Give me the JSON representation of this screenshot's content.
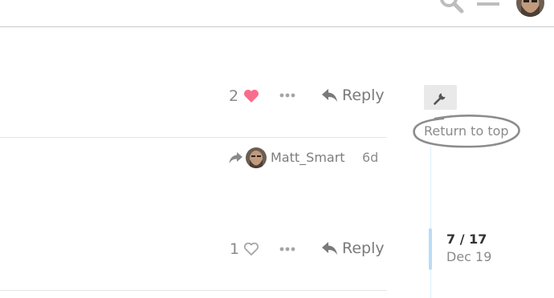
{
  "header": {
    "icons": [
      "search-icon",
      "hamburger-menu-icon",
      "user-avatar"
    ]
  },
  "post1": {
    "like_count": "2",
    "liked": true,
    "like_color": "#fa6c8d",
    "reply_label": "Reply"
  },
  "post2": {
    "reply_to_user": "Matt_Smart",
    "age": "6d",
    "like_count": "1",
    "liked": false,
    "reply_label": "Reply"
  },
  "timeline": {
    "return_to_top": "Return to top",
    "position": "7 / 17",
    "date": "Dec 19",
    "accent_color": "#b9dcf7"
  }
}
